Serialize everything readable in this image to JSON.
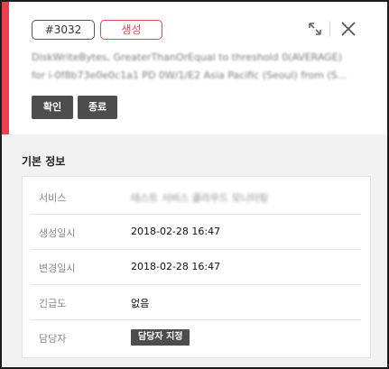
{
  "header": {
    "ticket_id": "#3032",
    "status": "생성",
    "message_line1": "DiskWriteBytes, GreaterThanOrEqual to threshold 0(AVERAGE)",
    "message_line2": "for i-0f8b73e0e0c1a1 PD 0W/1/E2 Asia Pacific (Seoul) from (S..."
  },
  "actions": {
    "confirm_label": "확인",
    "end_label": "종료"
  },
  "info": {
    "section_title": "기본 정보",
    "rows": [
      {
        "label": "서비스",
        "value": "테스트 서비스 클라우드 모니터링"
      },
      {
        "label": "생성일시",
        "value": "2018-02-28 16:47"
      },
      {
        "label": "변경일시",
        "value": "2018-02-28 16:47"
      },
      {
        "label": "긴급도",
        "value": "없음"
      },
      {
        "label": "담당자",
        "value": "담당자 지정"
      }
    ]
  },
  "colors": {
    "accent": "#ec3f4f",
    "dark_button": "#4d4d4d"
  },
  "icons": {
    "expand": "expand-icon",
    "close": "close-icon"
  }
}
